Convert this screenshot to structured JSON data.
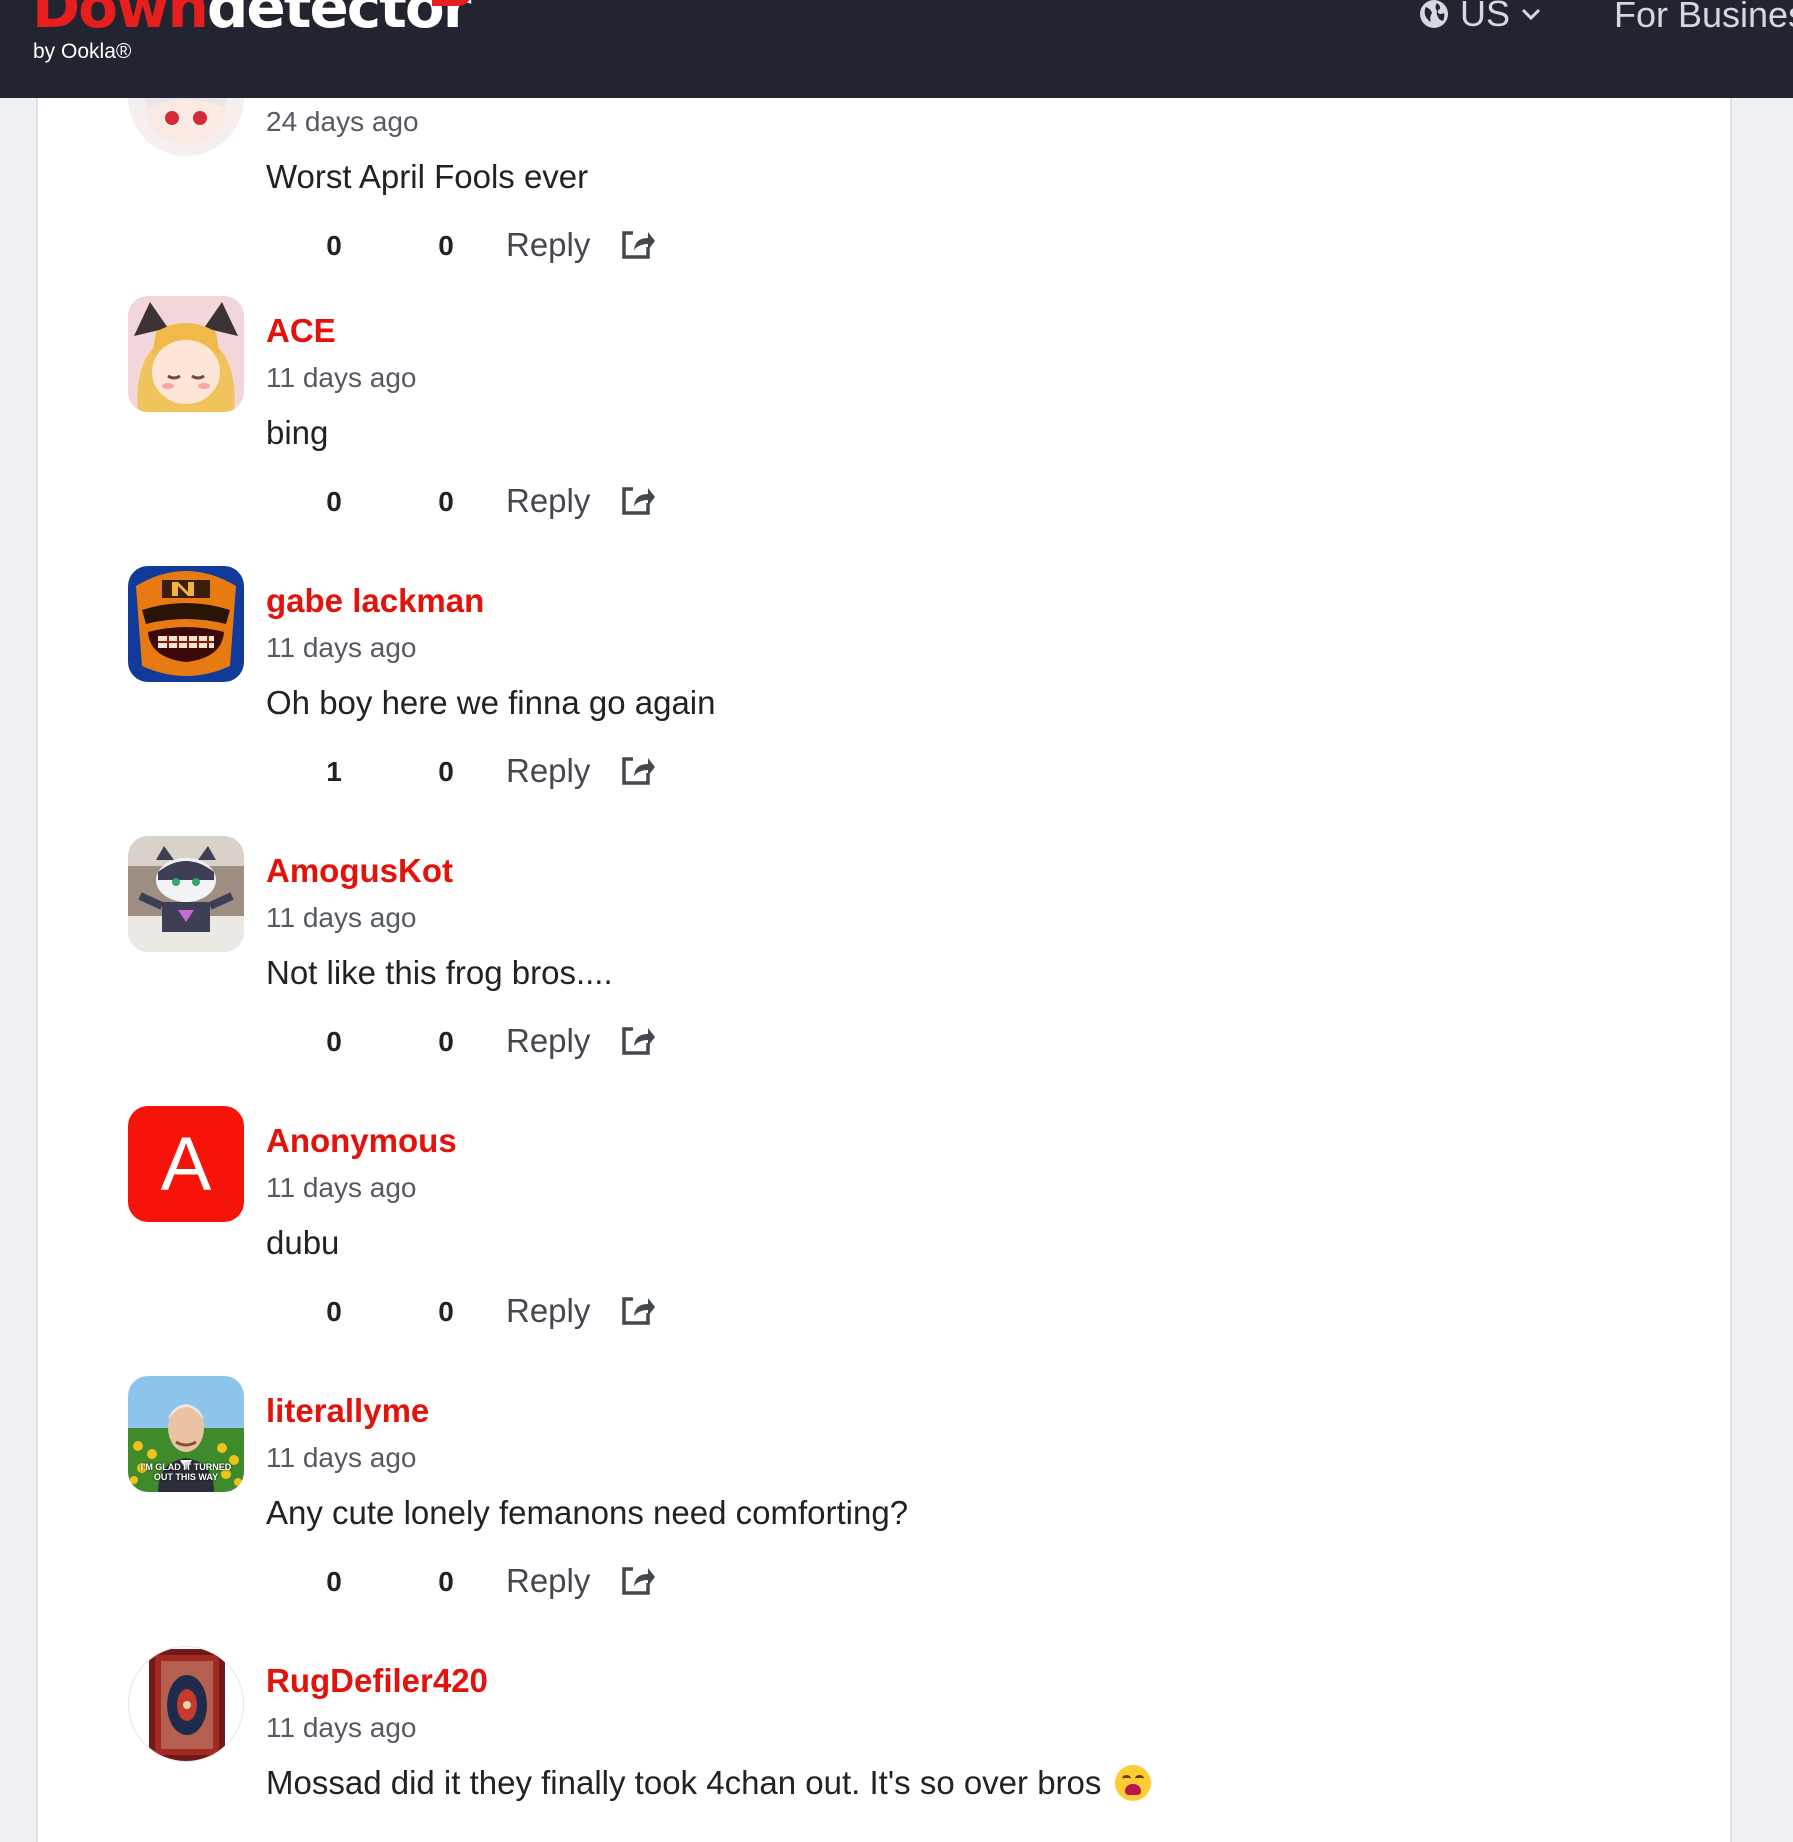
{
  "header": {
    "logo_red": "Down",
    "logo_white": "detector",
    "byline": "by Ookla®",
    "region_label": "US",
    "business_label": "For Business"
  },
  "icons": {
    "globe": "globe-icon",
    "chevron": "chevron-down-icon",
    "share": "share-icon"
  },
  "colors": {
    "brand_red": "#e3120b",
    "topbar_bg": "#22252f"
  },
  "comments": [
    {
      "user": "",
      "time": "24 days ago",
      "text": "Worst April Fools ever",
      "up": "0",
      "down": "0",
      "reply": "Reply"
    },
    {
      "user": "ACE",
      "time": "11 days ago",
      "text": "bing",
      "up": "0",
      "down": "0",
      "reply": "Reply"
    },
    {
      "user": "gabe lackman",
      "time": "11 days ago",
      "text": "Oh boy here we finna go again",
      "up": "1",
      "down": "0",
      "reply": "Reply"
    },
    {
      "user": "AmogusKot",
      "time": "11 days ago",
      "text": "Not like this frog bros....",
      "up": "0",
      "down": "0",
      "reply": "Reply"
    },
    {
      "user": "Anonymous",
      "time": "11 days ago",
      "text": "dubu",
      "up": "0",
      "down": "0",
      "reply": "Reply",
      "avatar_letter": "A"
    },
    {
      "user": "literallyme",
      "time": "11 days ago",
      "text": "Any cute lonely femanons need comforting?",
      "up": "0",
      "down": "0",
      "reply": "Reply",
      "avatar_caption": "I'M GLAD IT TURNED OUT THIS WAY"
    },
    {
      "user": "RugDefiler420",
      "time": "11 days ago",
      "text": "Mossad did it they finally took 4chan out. It's so over bros",
      "up": "",
      "down": "",
      "reply": ""
    }
  ]
}
